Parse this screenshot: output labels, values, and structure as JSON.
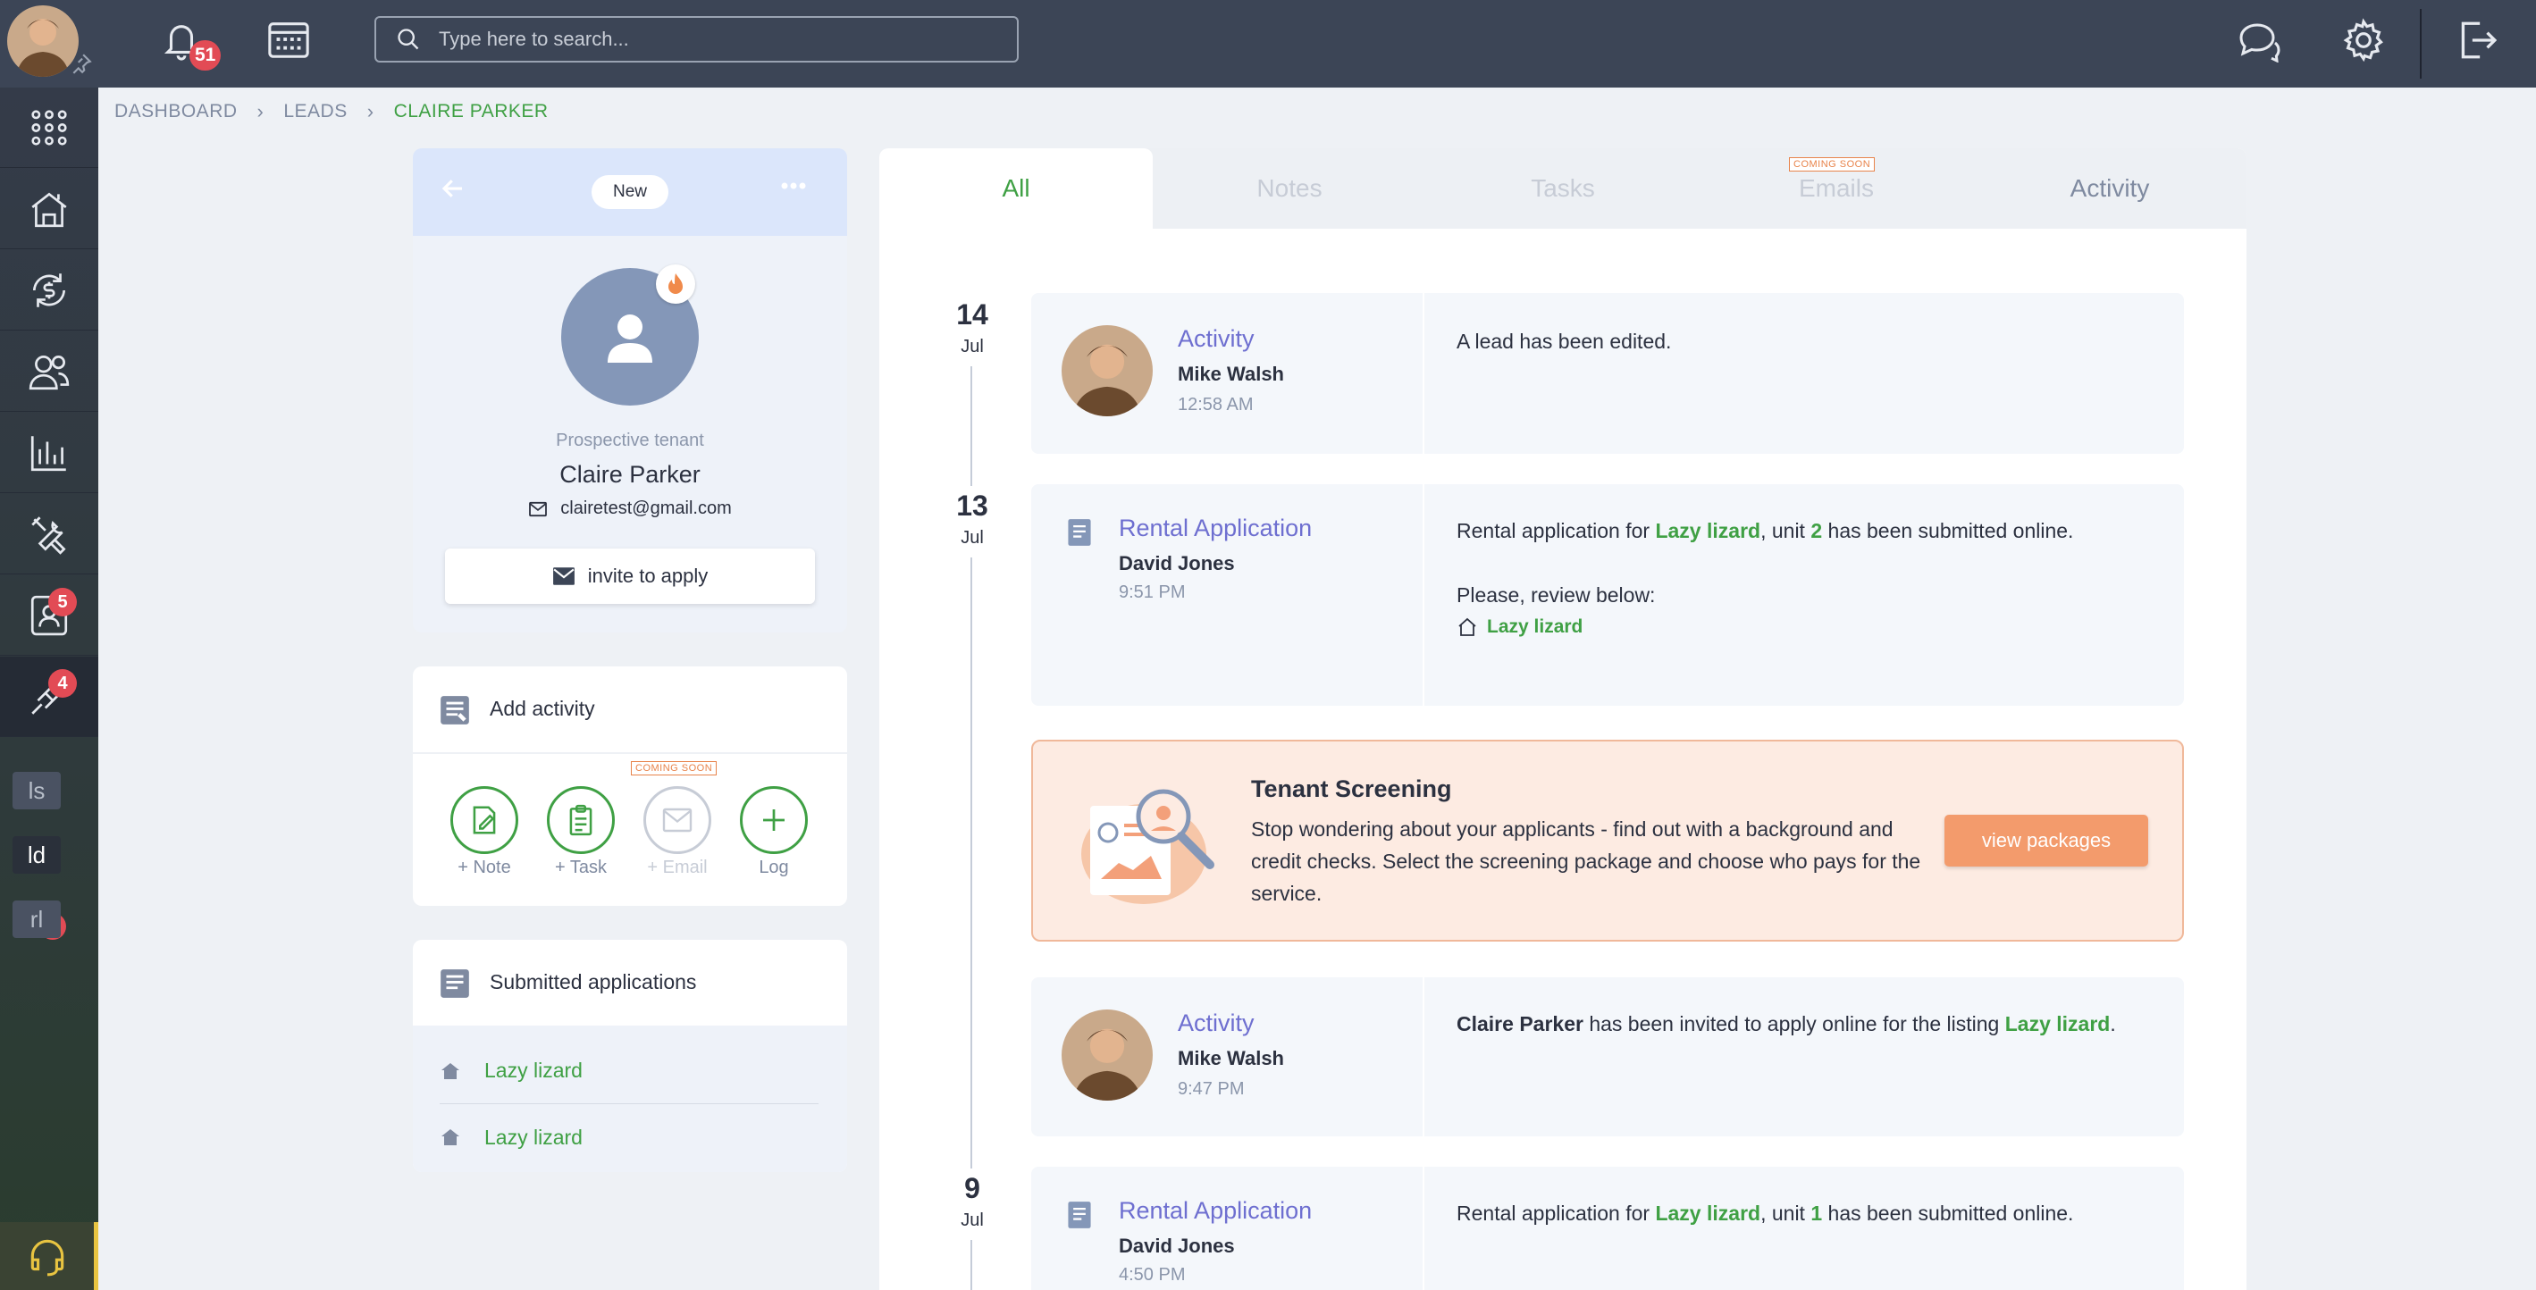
{
  "topbar": {
    "notifications_count": "51",
    "search_placeholder": "Type here to search..."
  },
  "sidebar": {
    "badges": {
      "applications": "5",
      "maintenance": "4",
      "ld": "4"
    },
    "letters": [
      "ls",
      "ld",
      "rl"
    ]
  },
  "breadcrumb": {
    "items": [
      "DASHBOARD",
      "LEADS",
      "CLAIRE PARKER"
    ]
  },
  "profile": {
    "status": "New",
    "role": "Prospective tenant",
    "name": "Claire Parker",
    "email": "clairetest@gmail.com",
    "invite_label": "invite to apply"
  },
  "add_activity": {
    "title": "Add activity",
    "coming_soon": "COMING SOON",
    "buttons": [
      "+ Note",
      "+ Task",
      "+ Email",
      "Log"
    ]
  },
  "submitted": {
    "title": "Submitted applications",
    "items": [
      "Lazy lizard",
      "Lazy lizard"
    ]
  },
  "tabs": {
    "items": [
      "All",
      "Notes",
      "Tasks",
      "Emails",
      "Activity"
    ],
    "active": "All",
    "coming_soon": "COMING SOON"
  },
  "timeline": {
    "dates": [
      {
        "day": "14",
        "month": "Jul"
      },
      {
        "day": "13",
        "month": "Jul"
      },
      {
        "day": "9",
        "month": "Jul"
      }
    ],
    "entries": [
      {
        "type": "Activity",
        "user": "Mike Walsh",
        "time": "12:58 AM",
        "text": "A lead has been edited."
      },
      {
        "type": "Rental Application",
        "user": "David Jones",
        "time": "9:51 PM",
        "text_pre": "Rental application for ",
        "listing": "Lazy lizard",
        "text_mid": ", unit ",
        "unit": "2",
        "text_post": " has been submitted online.",
        "review": "Please, review below:",
        "review_link": "Lazy lizard"
      },
      {
        "type": "Activity",
        "user": "Mike Walsh",
        "time": "9:47 PM",
        "name": "Claire Parker",
        "text_mid": " has been invited to apply online for the listing ",
        "listing": "Lazy lizard",
        "text_post": "."
      },
      {
        "type": "Rental Application",
        "user": "David Jones",
        "time": "4:50 PM",
        "text_pre": "Rental application for ",
        "listing": "Lazy lizard",
        "text_mid": ", unit ",
        "unit": "1",
        "text_post": " has been submitted online."
      }
    ]
  },
  "promo": {
    "title": "Tenant Screening",
    "text": "Stop wondering about your applicants - find out with a background and credit checks. Select the screening package and choose who pays for the service.",
    "button": "view packages"
  },
  "colors": {
    "topbar": "#3c4556",
    "accent_green": "#3fa044",
    "accent_purple": "#6e6fd0",
    "promo_orange": "#f39b6c",
    "badge_red": "#e24b55"
  }
}
